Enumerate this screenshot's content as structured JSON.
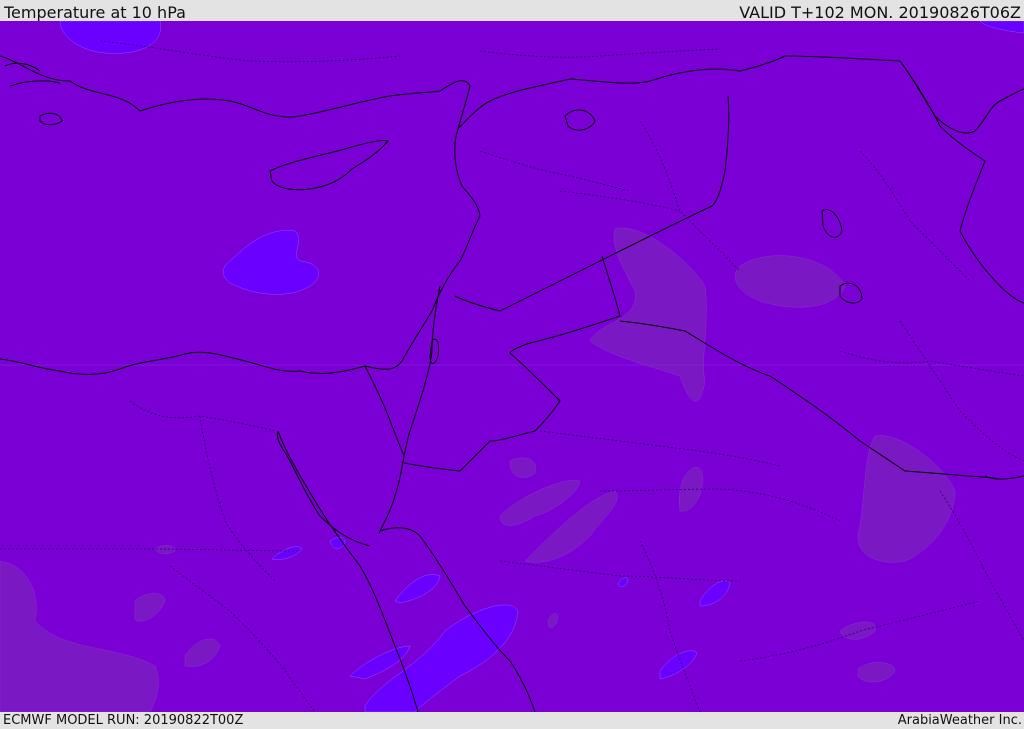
{
  "header": {
    "title": "Temperature at 10 hPa",
    "valid_time": "VALID T+102 MON. 20190826T06Z"
  },
  "footer": {
    "model_run": "ECMWF MODEL RUN: 20190822T00Z",
    "credit": "ArabiaWeather Inc."
  },
  "map": {
    "colors": {
      "base_field": "#7b00d6",
      "cold_field": "#6a00ff",
      "warm_field": "#7a18c4",
      "coastline": "#000000",
      "border": "#000000",
      "admin_border": "#2a0060"
    }
  }
}
